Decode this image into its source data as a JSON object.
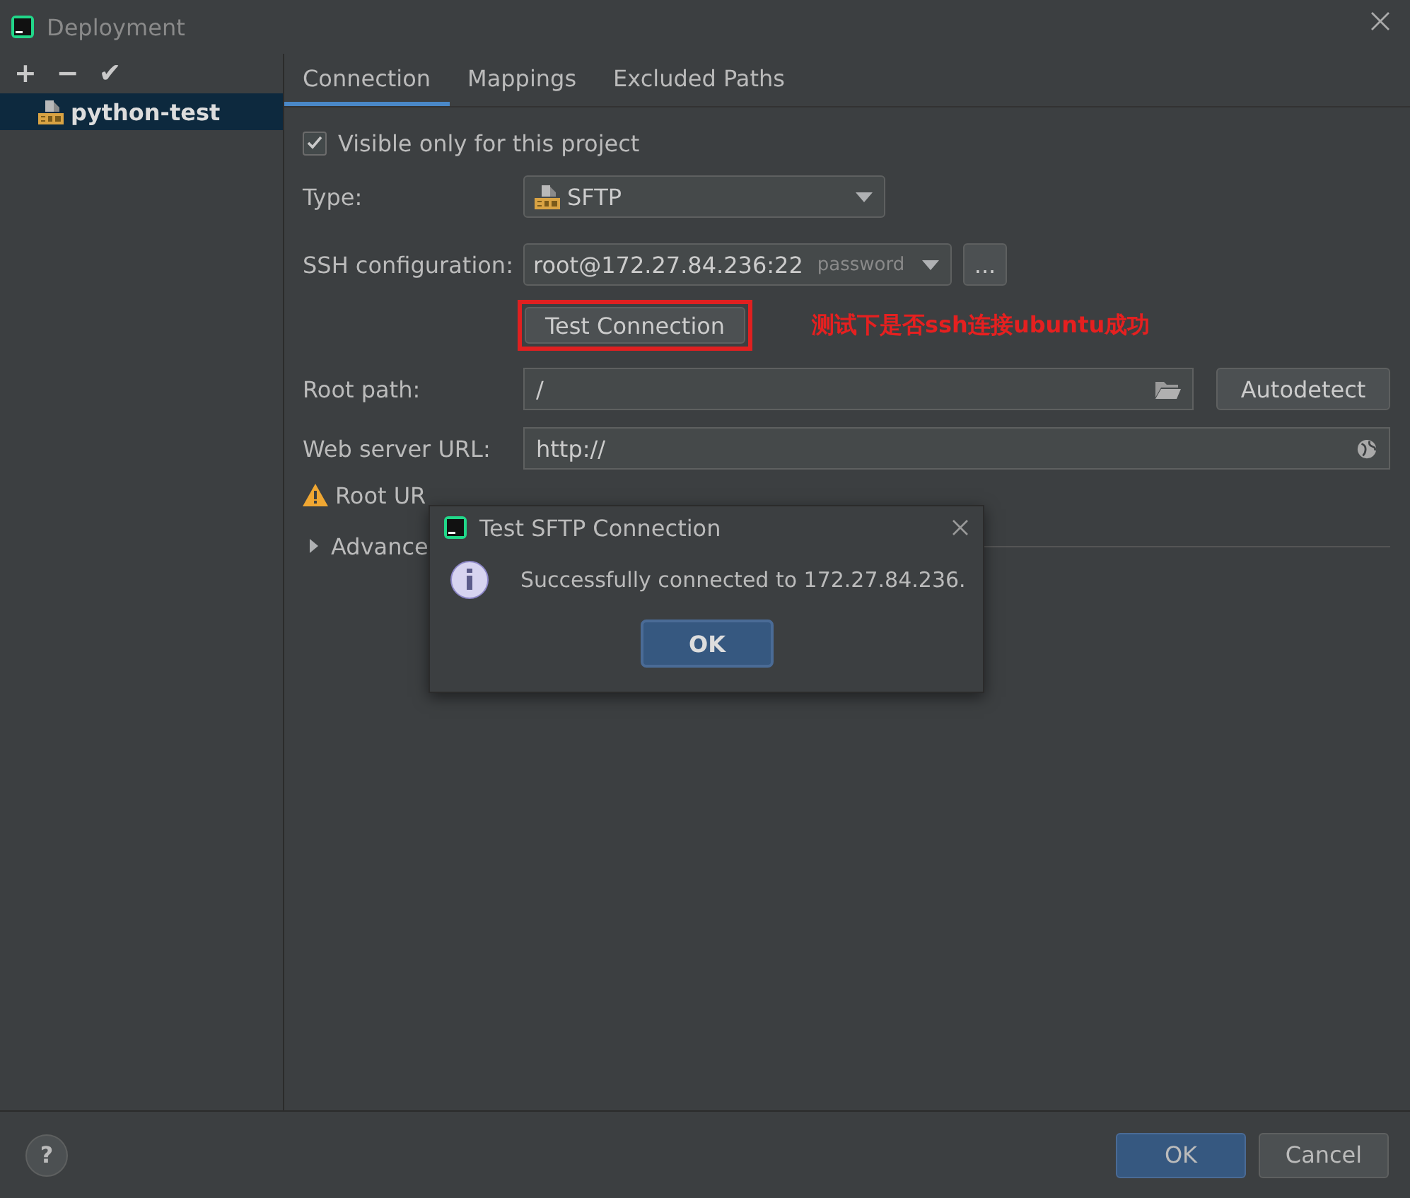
{
  "window": {
    "title": "Deployment"
  },
  "toolbar": [
    "+",
    "−",
    "✔"
  ],
  "servers": [
    {
      "name": "python-test",
      "selected": true
    }
  ],
  "tabs": [
    {
      "label": "Connection",
      "selected": true
    },
    {
      "label": "Mappings",
      "selected": false
    },
    {
      "label": "Excluded Paths",
      "selected": false
    }
  ],
  "visible_only": {
    "label": "Visible only for this project",
    "checked": true
  },
  "type": {
    "label": "Type:",
    "value": "SFTP"
  },
  "ssh": {
    "label": "SSH configuration:",
    "value": "root@172.27.84.236:22",
    "hint": "password",
    "more": "..."
  },
  "test_button": "Test Connection",
  "annotation": "测试下是否ssh连接ubuntu成功",
  "root_path": {
    "label": "Root path:",
    "value": "/",
    "button": "Autodetect"
  },
  "web_url": {
    "label": "Web server URL:",
    "value": "http://"
  },
  "warning": "Root UR",
  "advanced": {
    "label": "Advance",
    "expanded": false
  },
  "dialog": {
    "title": "Test SFTP Connection",
    "message": "Successfully connected to 172.27.84.236.",
    "button": "OK"
  },
  "help": "?",
  "buttons": [
    "OK",
    "Cancel"
  ]
}
